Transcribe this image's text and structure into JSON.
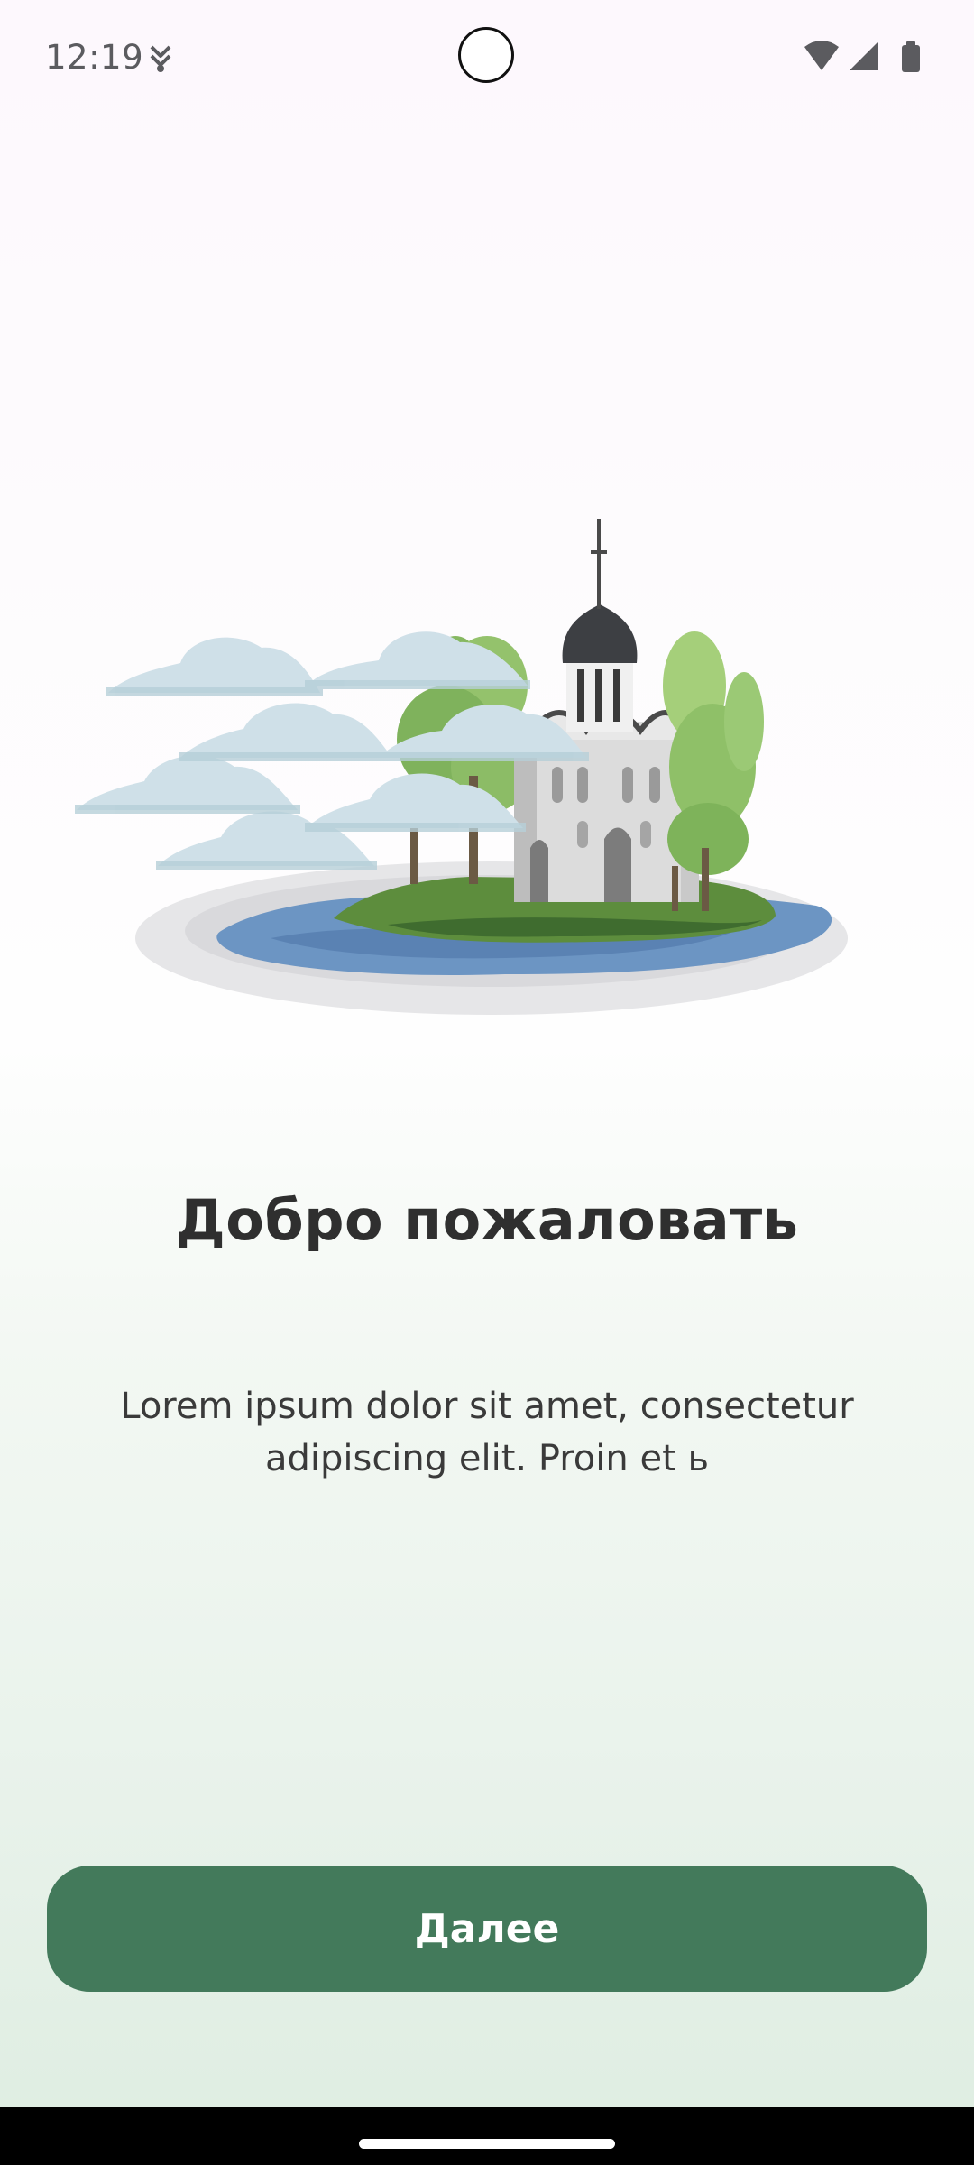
{
  "status_bar": {
    "time": "12:19",
    "app_icon": "notification-download-icon",
    "icons": [
      "wifi-icon",
      "signal-icon",
      "battery-icon"
    ]
  },
  "hero": {
    "illustration": "church-on-island-illustration"
  },
  "welcome": {
    "title": "Добро пожаловать",
    "description": "Lorem ipsum dolor sit amet, consectetur adipiscing elit. Proin et ь"
  },
  "actions": {
    "next_label": "Далее"
  },
  "colors": {
    "primary": "#437a5b",
    "title_text": "#2f2f2f",
    "body_text": "#3a3a3a",
    "background_top": "#fdf8fd",
    "background_bottom": "#deede1"
  }
}
